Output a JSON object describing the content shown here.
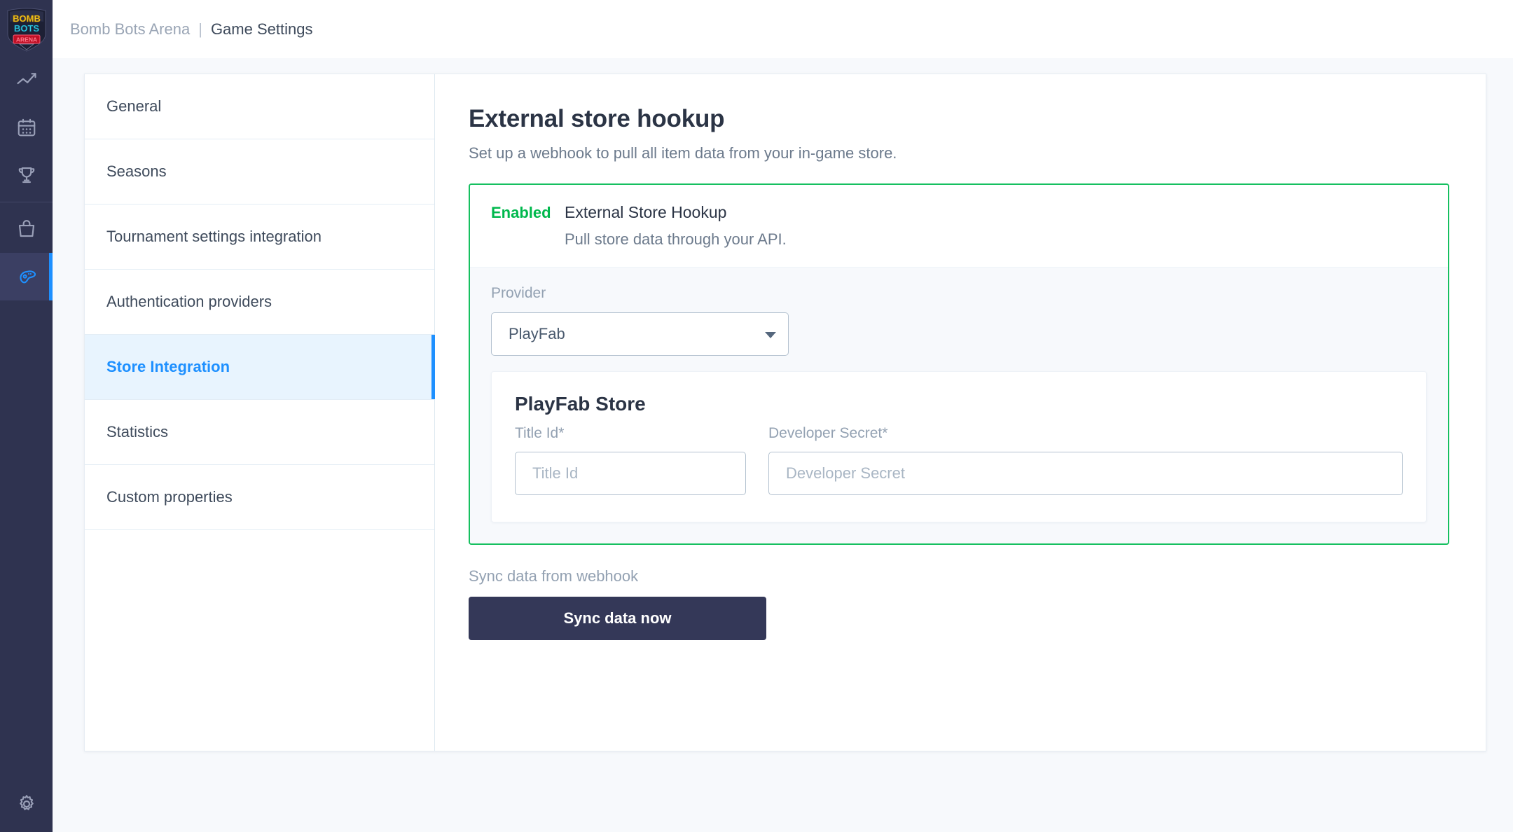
{
  "rail": {
    "logo": {
      "name": "bomb-bots-arena-logo",
      "line1": "BOMB",
      "line2": "BOTS",
      "line3": "ARENA",
      "color_line1": "#f5d020",
      "color_line2": "#31d0e8",
      "color_line3": "#ff2b4a"
    },
    "items": [
      {
        "icon": "analytics-line-chart-icon",
        "active": false
      },
      {
        "icon": "calendar-icon",
        "active": false
      },
      {
        "icon": "trophy-icon",
        "active": false
      },
      {
        "icon": "shopping-bag-icon",
        "active": false
      },
      {
        "icon": "gamepad-icon",
        "active": true
      }
    ],
    "bottom_item": {
      "icon": "gear-settings-icon"
    },
    "active_indicator_color": "#1e90ff"
  },
  "breadcrumb": {
    "project": "Bomb Bots Arena",
    "separator": "|",
    "current": "Game Settings"
  },
  "settings_menu": {
    "items": [
      {
        "label": "General",
        "active": false
      },
      {
        "label": "Seasons",
        "active": false
      },
      {
        "label": "Tournament settings integration",
        "active": false
      },
      {
        "label": "Authentication providers",
        "active": false
      },
      {
        "label": "Store Integration",
        "active": true
      },
      {
        "label": "Statistics",
        "active": false
      },
      {
        "label": "Custom properties",
        "active": false
      }
    ]
  },
  "content": {
    "title": "External store hookup",
    "subtitle": "Set up a webhook to pull all item data from your in-game store.",
    "hookup_card": {
      "status_badge": "Enabled",
      "status_color": "#00b84d",
      "border_color": "#16c060",
      "title": "External Store Hookup",
      "subtitle": "Pull store data through your API.",
      "provider_label": "Provider",
      "provider_value": "PlayFab",
      "provider_options": [
        "PlayFab"
      ],
      "store_card": {
        "title": "PlayFab Store",
        "title_id_label": "Title Id*",
        "title_id_value": "",
        "title_id_placeholder": "Title Id",
        "developer_secret_label": "Developer Secret*",
        "developer_secret_value": "",
        "developer_secret_placeholder": "Developer Secret"
      }
    },
    "sync_label": "Sync data from webhook",
    "sync_button": "Sync data now"
  }
}
